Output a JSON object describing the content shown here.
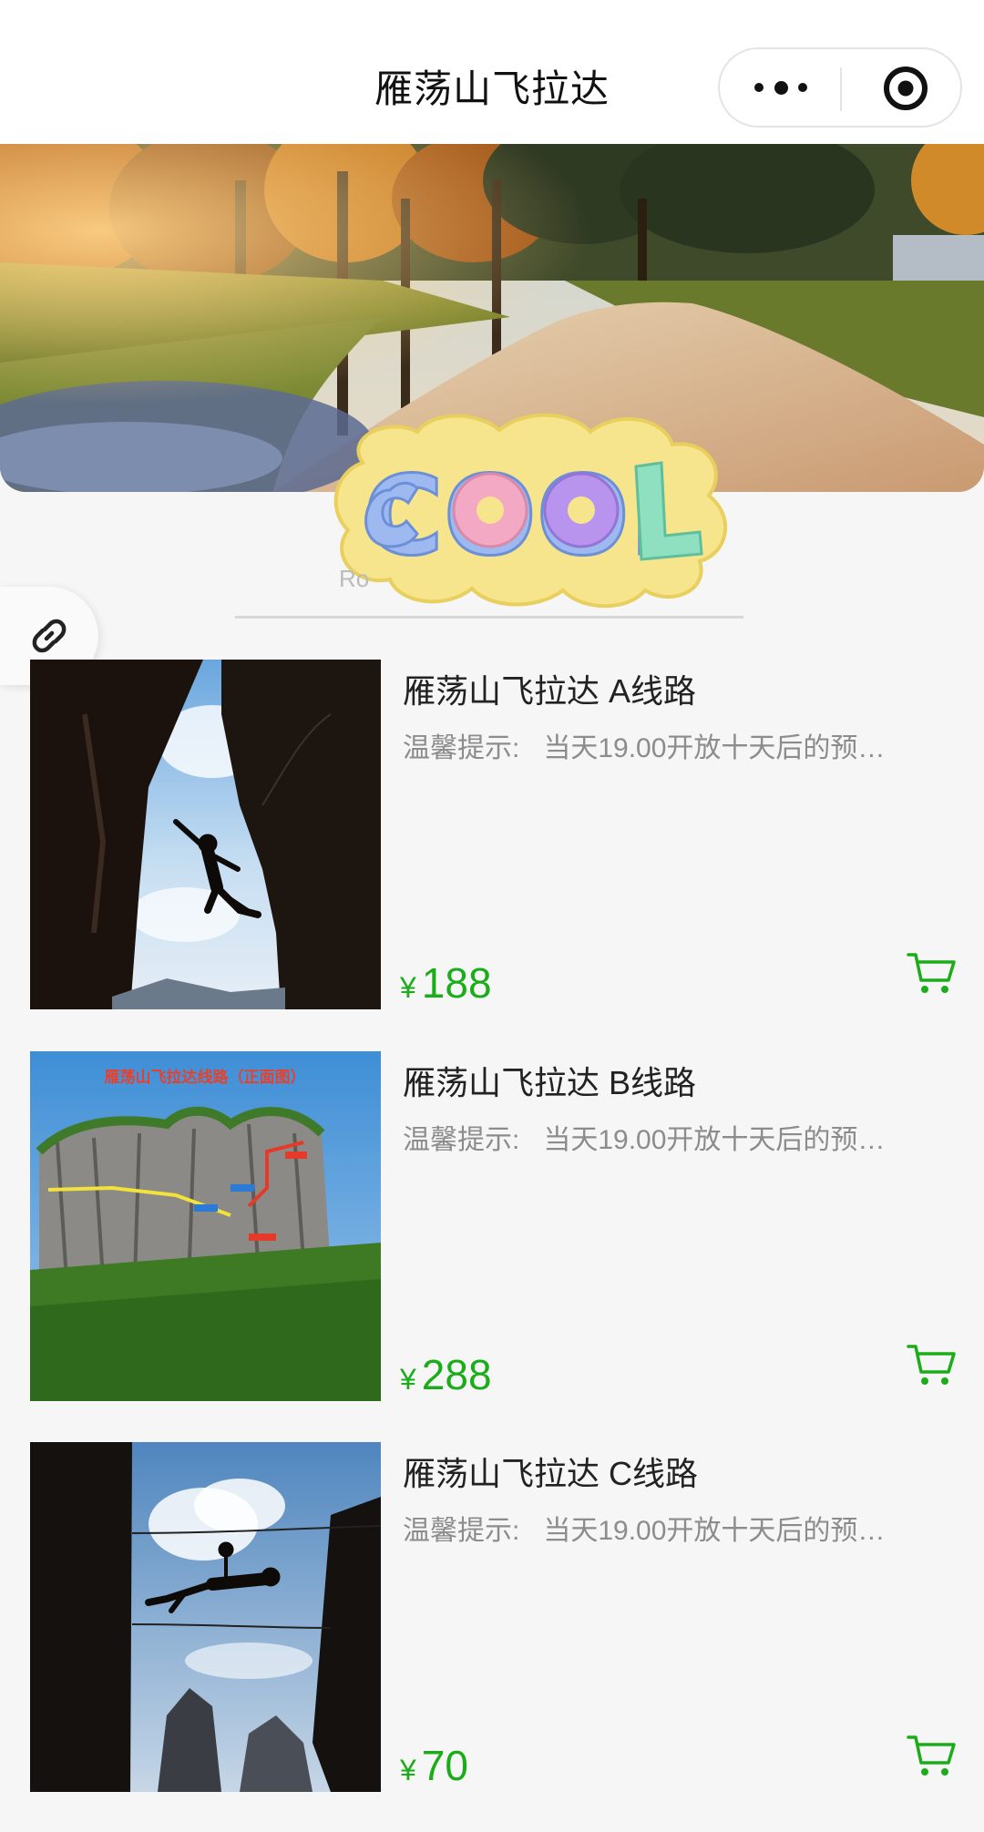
{
  "header": {
    "title": "雁荡山飞拉达",
    "more_icon": "more-dots-icon",
    "close_icon": "target-circle-icon"
  },
  "banner": {
    "sticker_text": "COOL"
  },
  "tab": {
    "partial_text": "Ro"
  },
  "link_button": {
    "icon": "link-icon"
  },
  "products": [
    {
      "name": "雁荡山飞拉达 A线路",
      "tip_label": "温馨提示:",
      "tip_text": "当天19.00开放十天后的预…",
      "currency": "¥",
      "price": "188",
      "cart_icon": "cart-icon"
    },
    {
      "name": "雁荡山飞拉达 B线路",
      "tip_label": "温馨提示:",
      "tip_text": "当天19.00开放十天后的预…",
      "currency": "¥",
      "price": "288",
      "cart_icon": "cart-icon",
      "map_title": "雁荡山飞拉达线路（正面图）"
    },
    {
      "name": "雁荡山飞拉达 C线路",
      "tip_label": "温馨提示:",
      "tip_text": "当天19.00开放十天后的预…",
      "currency": "¥",
      "price": "70",
      "cart_icon": "cart-icon"
    }
  ],
  "colors": {
    "price": "#1aad19",
    "cart": "#1aad19",
    "background": "#f6f6f6"
  }
}
